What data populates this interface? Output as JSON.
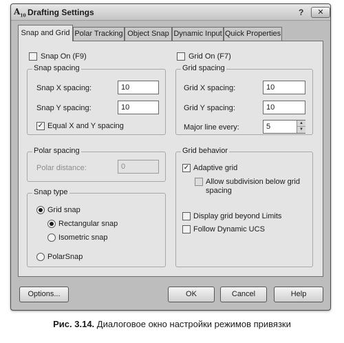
{
  "window": {
    "title": "Drafting Settings",
    "app_icon_letter": "A",
    "app_icon_suffix": "10",
    "help_glyph": "?",
    "close_glyph": "✕"
  },
  "tabs": [
    {
      "label": "Snap and Grid",
      "active": true
    },
    {
      "label": "Polar Tracking",
      "active": false
    },
    {
      "label": "Object Snap",
      "active": false
    },
    {
      "label": "Dynamic Input",
      "active": false
    },
    {
      "label": "Quick Properties",
      "active": false
    }
  ],
  "snap": {
    "snap_on_label": "Snap On (F9)",
    "snap_on_checked": false,
    "spacing_group": "Snap spacing",
    "x_label": "Snap X spacing:",
    "x_value": "10",
    "y_label": "Snap Y spacing:",
    "y_value": "10",
    "equal_label": "Equal X and Y spacing",
    "equal_checked": true,
    "polar_group": "Polar spacing",
    "polar_label": "Polar distance:",
    "polar_value": "0",
    "type_group": "Snap type",
    "grid_snap_label": "Grid snap",
    "rect_label": "Rectangular snap",
    "iso_label": "Isometric snap",
    "polar_snap_label": "PolarSnap",
    "selected_type": "Grid snap",
    "selected_style": "Rectangular snap"
  },
  "grid": {
    "grid_on_label": "Grid On (F7)",
    "grid_on_checked": false,
    "spacing_group": "Grid spacing",
    "x_label": "Grid X spacing:",
    "x_value": "10",
    "y_label": "Grid Y spacing:",
    "y_value": "10",
    "major_label": "Major line every:",
    "major_value": "5",
    "behavior_group": "Grid behavior",
    "adaptive_label": "Adaptive grid",
    "adaptive_checked": true,
    "subdivision_label_line1": "Allow subdivision below grid",
    "subdivision_label_line2": "spacing",
    "subdivision_checked": false,
    "beyond_label": "Display grid beyond Limits",
    "beyond_checked": false,
    "ucs_label": "Follow Dynamic UCS",
    "ucs_checked": false
  },
  "buttons": {
    "options": "Options...",
    "ok": "OK",
    "cancel": "Cancel",
    "help": "Help"
  },
  "caption": {
    "number": "Рис. 3.14.",
    "text": "Диалоговое окно настройки режимов привязки"
  },
  "icons": {
    "check_glyph": "✓",
    "spin_up_glyph": "▲",
    "spin_down_glyph": "▼"
  }
}
